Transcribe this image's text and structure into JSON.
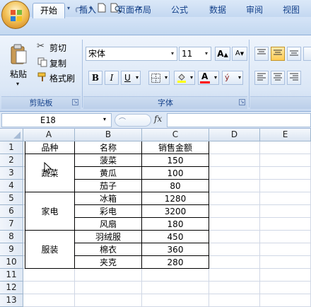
{
  "quick_access": {
    "save_icon": "save-icon",
    "undo_icon": "undo-icon",
    "redo_icon": "redo-icon",
    "new_icon": "new-document-icon",
    "print_preview_icon": "print-preview-icon",
    "customize_icon": "customize-dropdown-icon"
  },
  "tabs": [
    "开始",
    "插入",
    "页面布局",
    "公式",
    "数据",
    "审阅",
    "视图"
  ],
  "active_tab": "开始",
  "clipboard": {
    "paste_label": "粘贴",
    "cut_label": "剪切",
    "copy_label": "复制",
    "format_painter_label": "格式刷",
    "group_label": "剪贴板"
  },
  "font": {
    "font_name": "宋体",
    "font_size": "11",
    "group_label": "字体",
    "grow_label": "A",
    "shrink_label": "A",
    "bold": "B",
    "italic": "I",
    "underline": "U",
    "font_color_letter": "A",
    "phonetic_label": "ý",
    "highlight_color": "#ffff00",
    "font_color": "#ff0000"
  },
  "formula_bar": {
    "name_box": "E18",
    "fx": "fx",
    "formula": ""
  },
  "columns": [
    "A",
    "B",
    "C",
    "D",
    "E"
  ],
  "rows": [
    "1",
    "2",
    "3",
    "4",
    "5",
    "6",
    "7",
    "8",
    "9",
    "10",
    "11",
    "12",
    "13"
  ],
  "header_row": {
    "A": "品种",
    "B": "名称",
    "C": "销售金额"
  },
  "groups": [
    {
      "category": "蔬菜",
      "items": [
        {
          "name": "菠菜",
          "amount": "150"
        },
        {
          "name": "黄瓜",
          "amount": "100"
        },
        {
          "name": "茄子",
          "amount": "80"
        }
      ]
    },
    {
      "category": "家电",
      "items": [
        {
          "name": "冰箱",
          "amount": "1280"
        },
        {
          "name": "彩电",
          "amount": "3200"
        },
        {
          "name": "风扇",
          "amount": "180"
        }
      ]
    },
    {
      "category": "服装",
      "items": [
        {
          "name": "羽绒服",
          "amount": "450"
        },
        {
          "name": "棉衣",
          "amount": "360"
        },
        {
          "name": "夹克",
          "amount": "280"
        }
      ]
    }
  ],
  "colors": {
    "ribbon_text": "#15428b",
    "header_blue": "#dbe5f2",
    "grid_line": "#d0d7e5"
  }
}
